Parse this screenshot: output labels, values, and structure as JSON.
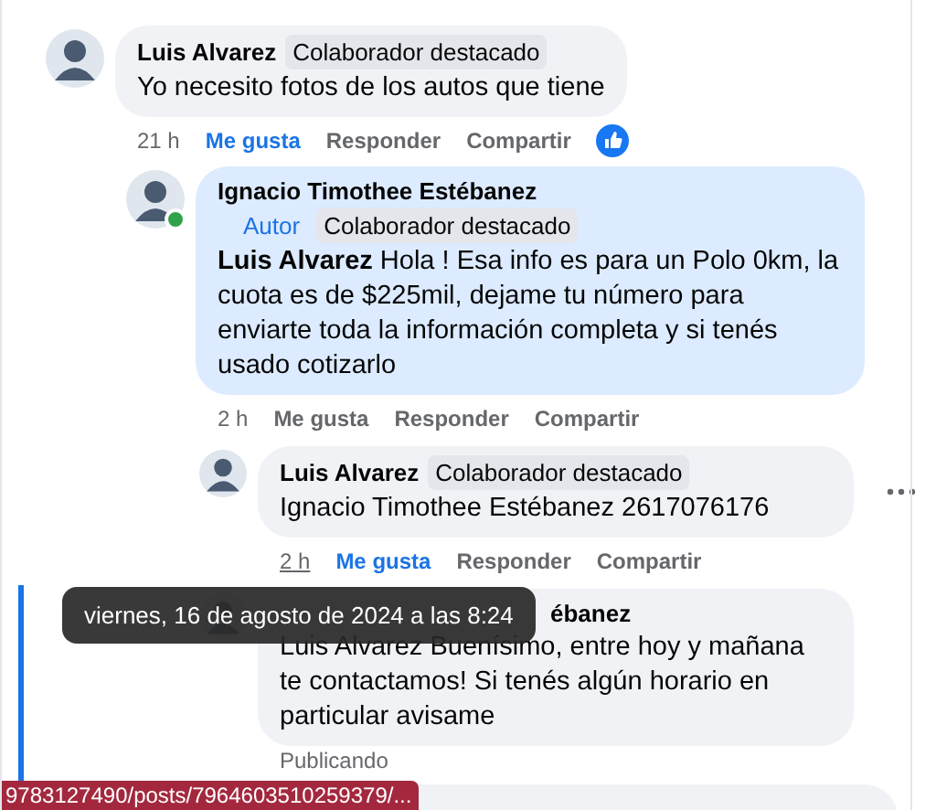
{
  "comments": [
    {
      "author": "Luis Alvarez",
      "badges": [
        {
          "label": "Colaborador destacado",
          "kind": "tag"
        }
      ],
      "text": "Yo necesito fotos de los autos que tiene",
      "time": "21 h",
      "time_hovered": false,
      "actions": [
        {
          "label": "Me gusta",
          "selected": true
        },
        {
          "label": "Responder",
          "selected": false
        },
        {
          "label": "Compartir",
          "selected": false
        }
      ],
      "liked": true,
      "children": [
        {
          "author": "Ignacio Timothee Estébanez",
          "online": true,
          "highlighted": true,
          "badges": [
            {
              "label": "Autor",
              "kind": "author"
            },
            {
              "label": "Colaborador destacado",
              "kind": "tag"
            }
          ],
          "text": "**Luis Alvarez** Hola ! Esa info es para un Polo 0km, la cuota es de $225mil, dejame tu número para enviarte toda la información completa y si tenés usado cotizarlo",
          "time": "2 h",
          "time_hovered": false,
          "actions": [
            {
              "label": "Me gusta",
              "selected": false
            },
            {
              "label": "Responder",
              "selected": false
            },
            {
              "label": "Compartir",
              "selected": false
            }
          ],
          "children": [
            {
              "author": "Luis Alvarez",
              "badges": [
                {
                  "label": "Colaborador destacado",
                  "kind": "tag"
                }
              ],
              "text": "Ignacio Timothee Estébanez 2617076176",
              "time": "2 h",
              "time_hovered": true,
              "more": true,
              "actions": [
                {
                  "label": "Me gusta",
                  "selected": true
                },
                {
                  "label": "Responder",
                  "selected": false
                },
                {
                  "label": "Compartir",
                  "selected": false
                }
              ]
            },
            {
              "author": "ébanez",
              "text": "Luis Alvarez Buenísimo, entre hoy y mañana te contactamos! Si tenés algún horario en particular avisame",
              "status": "Publicando"
            }
          ]
        }
      ]
    }
  ],
  "tooltip": "viernes, 16 de agosto de 2024 a las 8:24",
  "status_url": "9783127490/posts/7964603510259379/..."
}
